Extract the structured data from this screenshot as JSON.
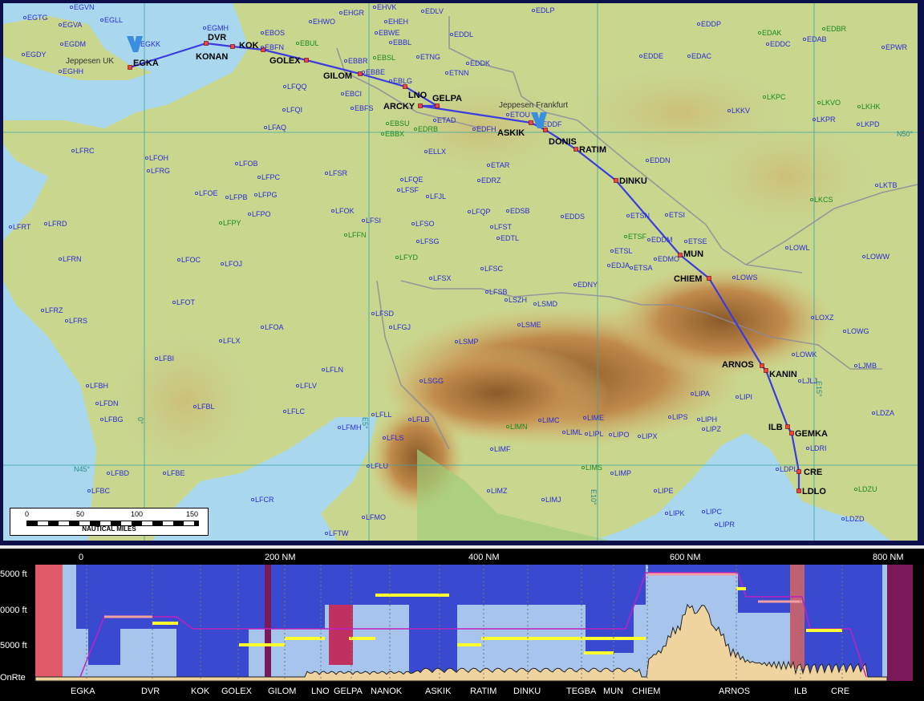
{
  "map": {
    "jeppesen_uk": "Jeppesen UK",
    "jeppesen_frankfurt": "Jeppesen Frankfurt",
    "grid_labels": {
      "n50": "N50°",
      "n45": "N45°",
      "e5": "E5°",
      "e10": "E10°",
      "e15": "E15°",
      "w0": "0°"
    },
    "scale": {
      "t0": "0",
      "t50": "50",
      "t100": "100",
      "t150": "150",
      "caption": "NAUTICAL MILES"
    },
    "route_fixes": [
      "EGKA",
      "DVR",
      "KONAN",
      "KOK",
      "GOLEX",
      "GILOM",
      "LNO",
      "GELPA",
      "ARCKY",
      "ASKIK",
      "DONIS",
      "RATIM",
      "DINKU",
      "MUN",
      "CHIEM",
      "ARNOS",
      "KANIN",
      "ILB",
      "GEMKA",
      "CRE",
      "LDLO"
    ],
    "airports": [
      "EGVN",
      "EGTG",
      "EGLL",
      "EGVA",
      "EGDM",
      "EGKK",
      "EGDY",
      "EGHH",
      "EGMH",
      "EHGR",
      "EHVK",
      "EDLV",
      "EDLP",
      "EHWO",
      "EHEH",
      "EBOS",
      "EBFN",
      "EBWE",
      "EBBL",
      "EDDL",
      "EDDP",
      "EDAK",
      "EDBR",
      "EDDC",
      "EDAB",
      "EPWR",
      "EBUL",
      "EBSL",
      "EDDE",
      "EDAC",
      "EBBR",
      "EBBE",
      "ETNG",
      "EDDK",
      "EBCI",
      "ETNN",
      "EBLG",
      "LFQQ",
      "LFQI",
      "EBFS",
      "ETAD",
      "ETOU",
      "EDDF",
      "EDFH",
      "EBSU",
      "EBBX",
      "EDRB",
      "LFAQ",
      "LKPC",
      "LKVO",
      "LKHK",
      "LKKV",
      "LKPR",
      "LKPD",
      "LFRC",
      "LFOH",
      "LFRG",
      "LFOB",
      "LFPC",
      "LFSR",
      "ELLX",
      "ETAR",
      "EDDN",
      "EDRZ",
      "LKTB",
      "LFOE",
      "LFPB",
      "LFPG",
      "LFQE",
      "LFSF",
      "LFJL",
      "LKCS",
      "LFRT",
      "LFRD",
      "LFPY",
      "LFPO",
      "LFOK",
      "LFSI",
      "LFFN",
      "LFQP",
      "EDSB",
      "EDDS",
      "ETSN",
      "ETSI",
      "LFSO",
      "LFST",
      "EDTL",
      "ETSF",
      "EDDM",
      "ETSE",
      "LFRN",
      "LFSG",
      "LFOC",
      "LFOJ",
      "LFYD",
      "LFSC",
      "ETSL",
      "EDMO",
      "EDJA",
      "ETSA",
      "LOWL",
      "LOWW",
      "LFSX",
      "EDNY",
      "LOWS",
      "LFRZ",
      "LFSB",
      "LSZH",
      "LSMD",
      "LFOT",
      "LFRS",
      "LFSD",
      "LFGJ",
      "LSME",
      "LOXZ",
      "LOWG",
      "LFOA",
      "LSMP",
      "LFLX",
      "LOWK",
      "LJMB",
      "LFBI",
      "LFLN",
      "LFLV",
      "LSGG",
      "LJLJ",
      "LFBH",
      "LFDN",
      "LFBL",
      "LFLC",
      "LFLL",
      "LFLB",
      "LIPA",
      "LIPI",
      "LIMC",
      "LIME",
      "LIPH",
      "LIPS",
      "LDZA",
      "LFBG",
      "LFMH",
      "LFLS",
      "LIMN",
      "LIML",
      "LIPL",
      "LIPO",
      "LIPX",
      "LIPZ",
      "LDRI",
      "LIMF",
      "LFLU",
      "LIMS",
      "LIMP",
      "LDPL",
      "LFBD",
      "LFBE",
      "LIMZ",
      "LIMJ",
      "LIPE",
      "LDZU",
      "LFBC",
      "LFCR",
      "LIPK",
      "LIPC",
      "LIPR",
      "LFMO",
      "LDZD",
      "LFTW"
    ]
  },
  "profile": {
    "distance_labels": [
      "0",
      "200 NM",
      "400 NM",
      "600 NM",
      "800 NM"
    ],
    "altitude_labels": [
      "5000 ft",
      "0000 ft",
      "5000 ft",
      "OnRte"
    ],
    "fix_labels": [
      "EGKA",
      "DVR",
      "KOK",
      "GOLEX",
      "GILOM",
      "LNO",
      "GELPA",
      "NANOK",
      "ASKIK",
      "RATIM",
      "DINKU",
      "TEGBA",
      "MUN",
      "CHIEM",
      "ARNOS",
      "ILB",
      "CRE"
    ]
  }
}
